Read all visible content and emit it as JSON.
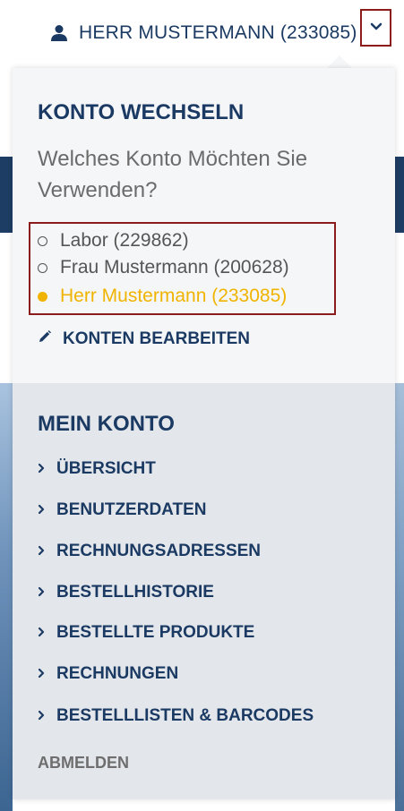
{
  "header": {
    "user_label": "HERR MUSTERMANN (233085)"
  },
  "switch_account": {
    "title": "KONTO WECHSELN",
    "question": "Welches Konto Möchten Sie Verwenden?",
    "accounts": [
      {
        "label": "Labor (229862)",
        "selected": false
      },
      {
        "label": "Frau Mustermann (200628)",
        "selected": false
      },
      {
        "label": "Herr Mustermann (233085)",
        "selected": true
      }
    ],
    "edit_label": "KONTEN BEARBEITEN"
  },
  "my_account": {
    "title": "MEIN KONTO",
    "items": [
      "ÜBERSICHT",
      "BENUTZERDATEN",
      "RECHNUNGSADRESSEN",
      "BESTELLHISTORIE",
      "BESTELLTE PRODUKTE",
      "RECHNUNGEN",
      "BESTELLLISTEN & BARCODES"
    ],
    "logout_label": "ABMELDEN"
  },
  "colors": {
    "primary": "#1b3a63",
    "accent": "#f0b400",
    "highlight_border": "#8b1c1c"
  }
}
